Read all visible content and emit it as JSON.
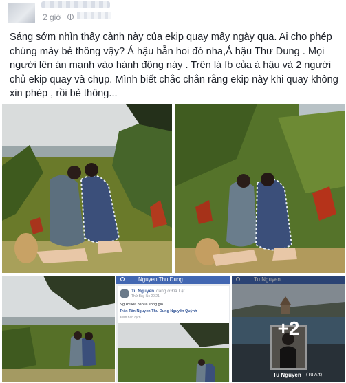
{
  "post": {
    "time": "2 giờ",
    "caption": "Sáng sớm nhìn thấy cảnh này của ekip quay mấy ngày qua. Ai cho phép chúng mày bẻ thông vậy? Á hậu hẵn hoi đó nha,Á hậu Thư Dung . Mọi người lên án mạnh vào hành động này . Trên là fb của á hậu và 2 người chủ ekip quay và chụp. Mình biết chắc chắn rằng ekip này khi quay không xin phép , rồi bẻ thông..."
  },
  "thumb2": {
    "search_name": "Nguyen Thu Dung",
    "poster": "Tu Nguyen",
    "checkin": "đang ở Đà Lạt.",
    "date": "Thứ Bảy lúc 20:21",
    "post_text": "Người kia bao la sóng gió",
    "tags": "Trần Tấn Nguyen Thu Dung Nguyễn Quỳnh",
    "translate": "Xem bản dịch"
  },
  "thumb3": {
    "search_name": "Tu Nguyen",
    "profile_name": "Tu Nguyen",
    "profile_alt": "(Tu Art)",
    "more_count": "+2"
  },
  "colors": {
    "facebook_blue": "#4267b2",
    "text": "#1d2129",
    "meta": "#90949c"
  }
}
